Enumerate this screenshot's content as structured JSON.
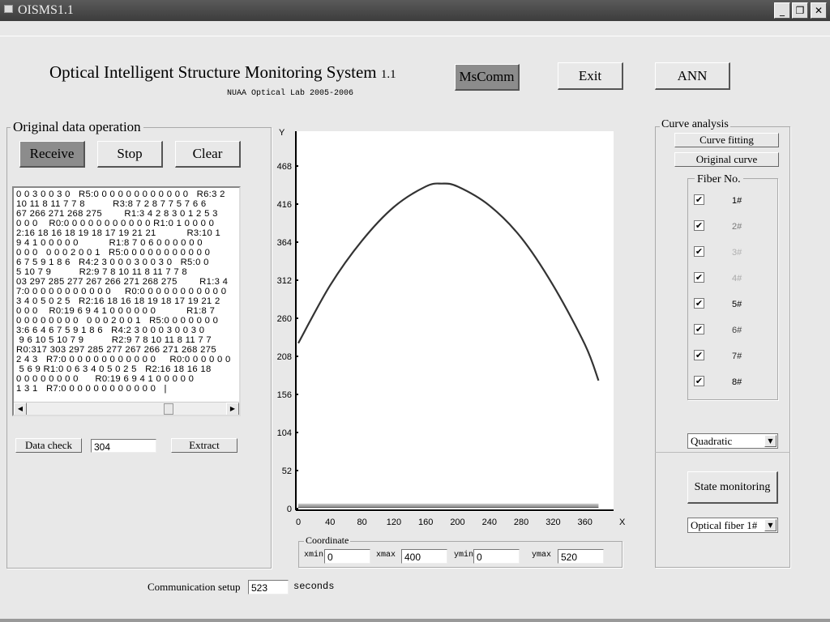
{
  "window": {
    "title": "OISMS1.1",
    "minimize": "_",
    "restore": "❐",
    "close": "✕"
  },
  "header": {
    "title": "Optical Intelligent Structure Monitoring System",
    "version": "1.1",
    "subtitle": "NUAA Optical Lab 2005-2006"
  },
  "top_buttons": {
    "mscomm": "MsComm",
    "exit": "Exit",
    "ann": "ANN"
  },
  "original": {
    "legend": "Original data operation",
    "receive": "Receive",
    "stop": "Stop",
    "clear": "Clear",
    "lines": [
      "0 0 3 0 0 3 0   R5:0 0 0 0 0 0 0 0 0 0 0 0   R6:3 2",
      "10 11 8 11 7 7 8          R3:8 7 2 8 7 7 5 7 6 6",
      "67 266 271 268 275        R1:3 4 2 8 3 0 1 2 5 3",
      "0 0 0    R0:0 0 0 0 0 0 0 0 0 0 0 R1:0 1 0 0 0 0",
      "2:16 18 16 18 19 18 17 19 21 21           R3:10 1",
      "9 4 1 0 0 0 0 0           R1:8 7 0 6 0 0 0 0 0 0",
      "0 0 0   0 0 0 2 0 0 1   R5:0 0 0 0 0 0 0 0 0 0 0",
      "6 7 5 9 1 8 6   R4:2 3 0 0 0 3 0 0 3 0   R5:0 0",
      "5 10 7 9          R2:9 7 8 10 11 8 11 7 7 8",
      "03 297 285 277 267 266 271 268 275        R1:3 4",
      "7:0 0 0 0 0 0 0 0 0 0 0     R0:0 0 0 0 0 0 0 0 0 0 0",
      "3 4 0 5 0 2 5   R2:16 18 16 18 19 18 17 19 21 2",
      "0 0 0    R0:19 6 9 4 1 0 0 0 0 0 0           R1:8 7",
      "0 0 0 0 0 0 0 0   0 0 0 2 0 0 1   R5:0 0 0 0 0 0 0",
      "3:6 6 4 6 7 5 9 1 8 6   R4:2 3 0 0 0 3 0 0 3 0",
      " 9 6 10 5 10 7 9          R2:9 7 8 10 11 8 11 7 7",
      "R0:317 303 297 285 277 267 266 271 268 275",
      "2 4 3   R7:0 0 0 0 0 0 0 0 0 0 0 0     R0:0 0 0 0 0 0",
      " 5 6 9 R1:0 0 6 3 4 0 5 0 2 5   R2:16 18 16 18",
      "0 0 0 0 0 0 0 0      R0:19 6 9 4 1 0 0 0 0 0",
      "1 3 1   R7:0 0 0 0 0 0 0 0 0 0 0 0   |"
    ],
    "data_check": "Data check",
    "data_check_value": "304",
    "extract": "Extract"
  },
  "communication": {
    "label": "Communication setup",
    "value": "523",
    "unit": "seconds"
  },
  "coordinate": {
    "legend": "Coordinate",
    "xmin_label": "xmin",
    "xmin": "0",
    "xmax_label": "xmax",
    "xmax": "400",
    "ymin_label": "ymin",
    "ymin": "0",
    "ymax_label": "ymax",
    "ymax": "520"
  },
  "chart_data": {
    "type": "line",
    "xlabel": "X",
    "ylabel": "Y",
    "xlim": [
      0,
      400
    ],
    "ylim": [
      0,
      520
    ],
    "xticks": [
      "0",
      "40",
      "80",
      "120",
      "160",
      "200",
      "240",
      "280",
      "320",
      "360"
    ],
    "yticks": [
      "0",
      "52",
      "104",
      "156",
      "208",
      "260",
      "312",
      "364",
      "416",
      "468"
    ],
    "grid": false,
    "series": [
      {
        "x": [
          0,
          40,
          80,
          120,
          160,
          180,
          200,
          240,
          280,
          320,
          360,
          377
        ],
        "y": [
          226,
          305,
          366,
          412,
          440,
          444,
          440,
          414,
          370,
          305,
          224,
          175
        ],
        "color": "#333333"
      },
      {
        "x": [
          0,
          377
        ],
        "y": [
          2,
          2
        ],
        "color": "#555555"
      },
      {
        "x": [
          0,
          377
        ],
        "y": [
          4,
          4
        ],
        "color": "#999999"
      },
      {
        "x": [
          0,
          377
        ],
        "y": [
          6,
          6
        ],
        "color": "#bbbbbb"
      }
    ]
  },
  "curve": {
    "legend": "Curve analysis",
    "fitting": "Curve fitting",
    "original": "Original curve",
    "fiber_legend": "Fiber No.",
    "fibers": [
      {
        "label": "1#",
        "checked": true,
        "color": "#000000"
      },
      {
        "label": "2#",
        "checked": true,
        "color": "#777777"
      },
      {
        "label": "3#",
        "checked": true,
        "color": "#b0b0b0"
      },
      {
        "label": "4#",
        "checked": true,
        "color": "#a8a8a8"
      },
      {
        "label": "5#",
        "checked": true,
        "color": "#000000"
      },
      {
        "label": "6#",
        "checked": true,
        "color": "#444444"
      },
      {
        "label": "7#",
        "checked": true,
        "color": "#222222"
      },
      {
        "label": "8#",
        "checked": true,
        "color": "#000000"
      }
    ],
    "check_mark": "✔",
    "fit_type": "Quadratic",
    "state_monitoring": "State monitoring",
    "fiber_select": "Optical fiber 1#"
  }
}
